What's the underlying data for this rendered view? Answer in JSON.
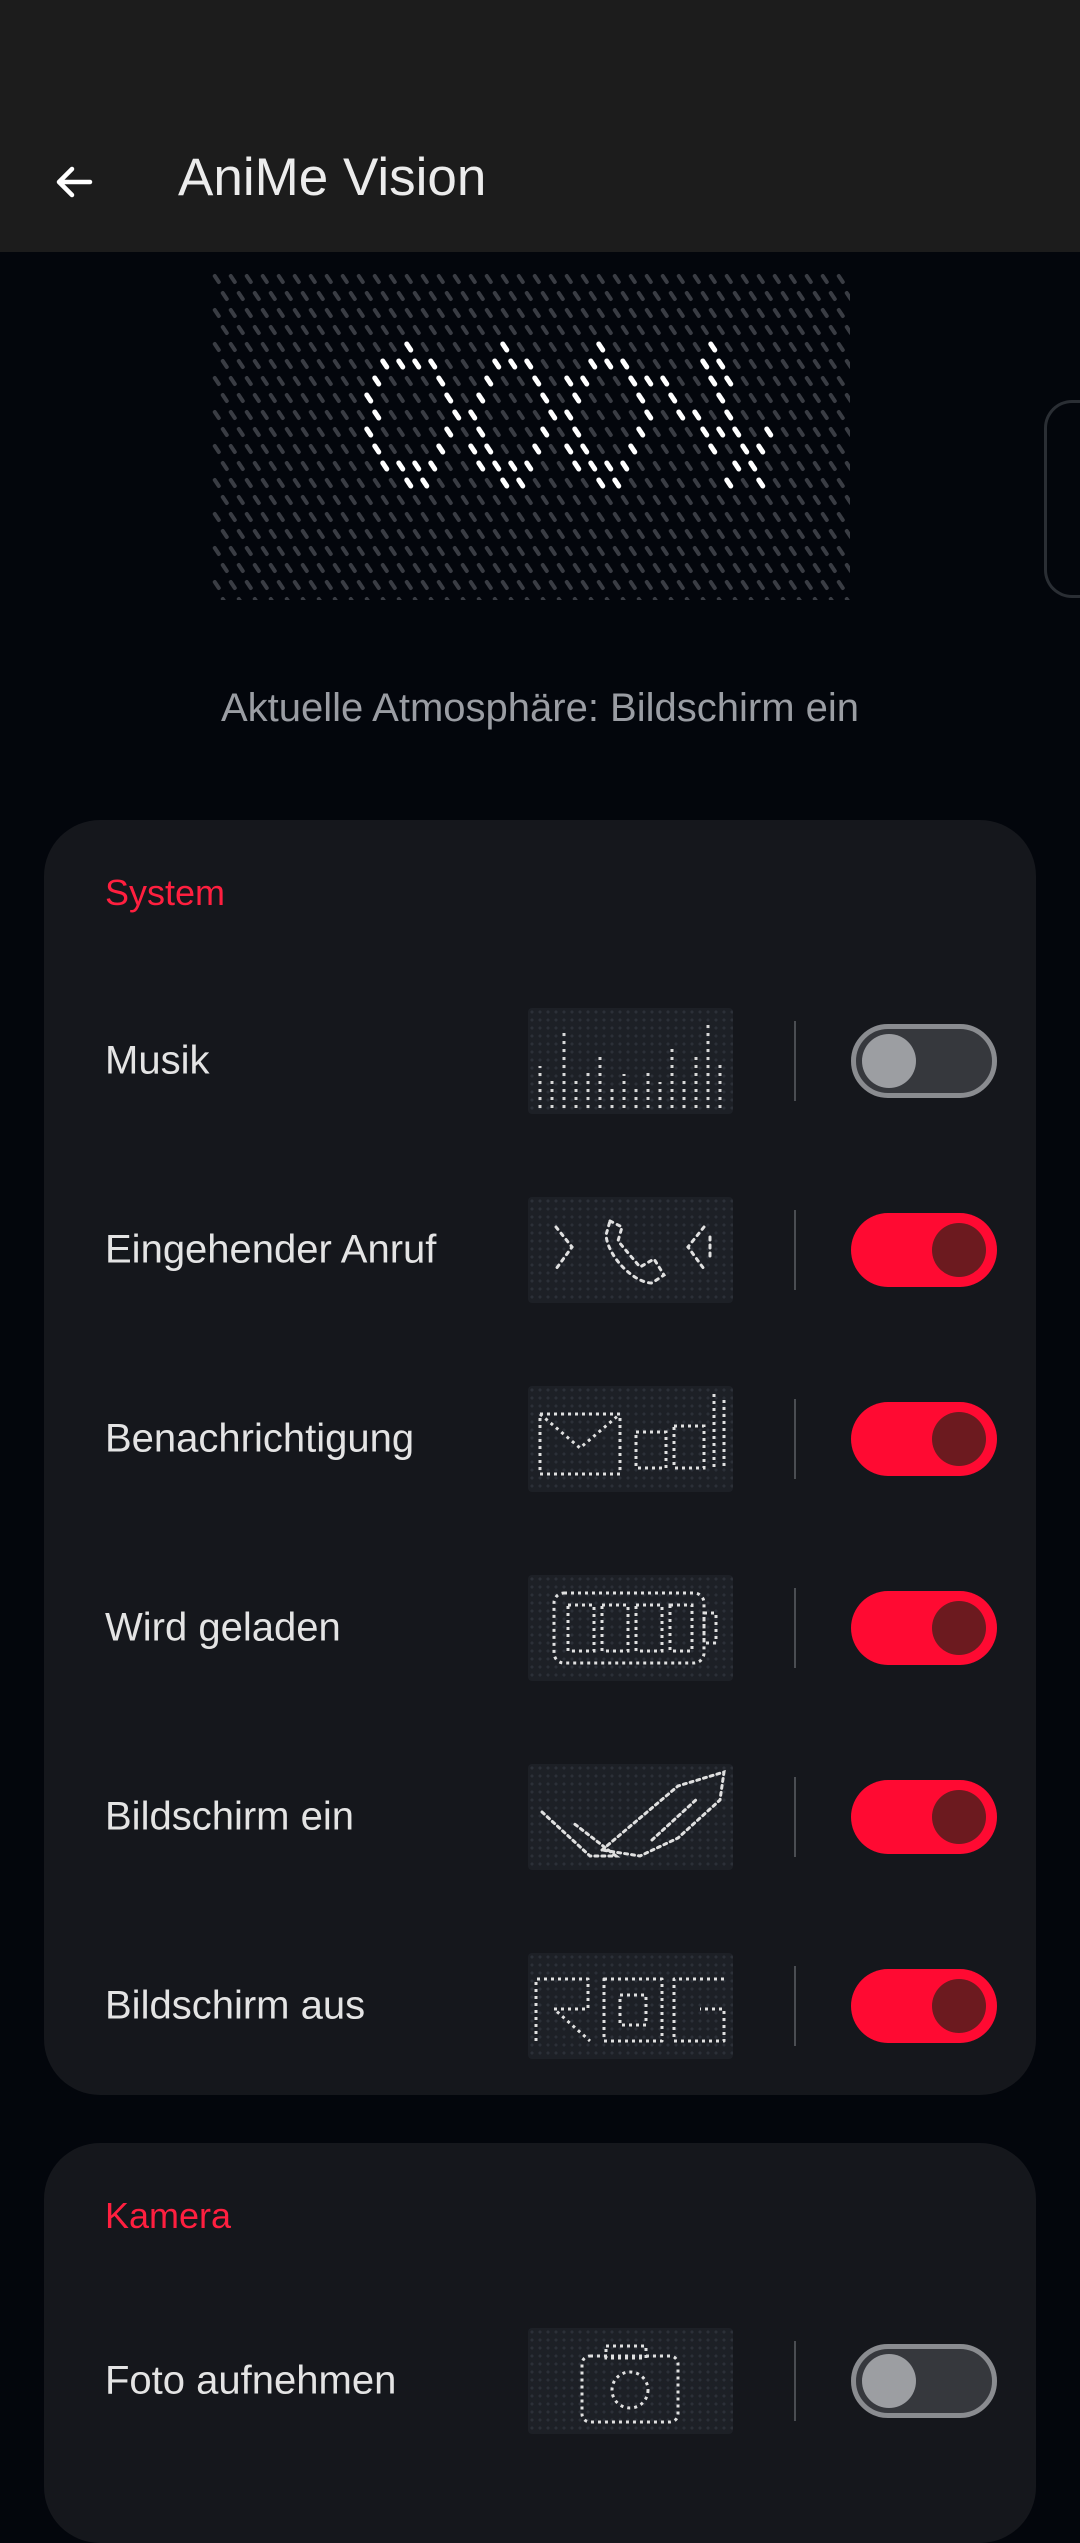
{
  "header": {
    "title": "AniMe Vision",
    "back_icon": "arrow-left-icon"
  },
  "preview": {
    "status_text": "Aktuelle Atmosphäre: Bildschirm ein"
  },
  "sections": [
    {
      "title": "System",
      "items": [
        {
          "label": "Musik",
          "enabled": false,
          "thumbnail": "equalizer-animation"
        },
        {
          "label": "Eingehender Anruf",
          "enabled": true,
          "thumbnail": "phone-call-animation"
        },
        {
          "label": "Benachrichtigung",
          "enabled": true,
          "thumbnail": "mail-notification-animation"
        },
        {
          "label": "Wird geladen",
          "enabled": true,
          "thumbnail": "battery-charging-animation"
        },
        {
          "label": "Bildschirm ein",
          "enabled": true,
          "thumbnail": "rog-eye-logo-animation"
        },
        {
          "label": "Bildschirm aus",
          "enabled": true,
          "thumbnail": "rog-text-animation"
        }
      ]
    },
    {
      "title": "Kamera",
      "items": [
        {
          "label": "Foto aufnehmen",
          "enabled": false,
          "thumbnail": "camera-animation"
        }
      ]
    }
  ],
  "colors": {
    "accent": "#ff0a32",
    "section_title": "#ff1f3f",
    "background": "#03060c",
    "card": "#15171c",
    "appbar": "#1c1c1c"
  }
}
